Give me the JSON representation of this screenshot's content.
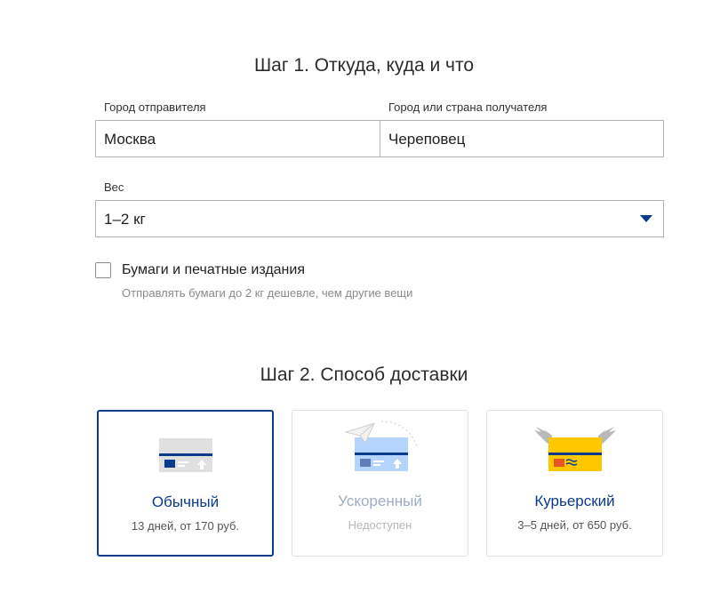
{
  "step1": {
    "title": "Шаг 1. Откуда, куда и что",
    "from_label": "Город отправителя",
    "from_value": "Москва",
    "to_label": "Город или страна получателя",
    "to_value": "Череповец",
    "weight_label": "Вес",
    "weight_value": "1–2 кг",
    "paper_label": "Бумаги и печатные издания",
    "paper_hint": "Отправлять бумаги до 2 кг дешевле, чем другие вещи",
    "paper_checked": false
  },
  "step2": {
    "title": "Шаг 2. Способ доставки",
    "options": [
      {
        "title": "Обычный",
        "subtitle": "13 дней, от 170 руб.",
        "icon": "parcel-icon",
        "state": "selected"
      },
      {
        "title": "Ускоренный",
        "subtitle": "Недоступен",
        "icon": "express-parcel-icon",
        "state": "disabled"
      },
      {
        "title": "Курьерский",
        "subtitle": "3–5 дней, от 650 руб.",
        "icon": "courier-parcel-icon",
        "state": "available"
      }
    ]
  },
  "colors": {
    "accent": "#0a3a8c",
    "disabled_text": "#9aaec6",
    "border": "#b4b4b4",
    "courier_box": "#ffc700"
  }
}
